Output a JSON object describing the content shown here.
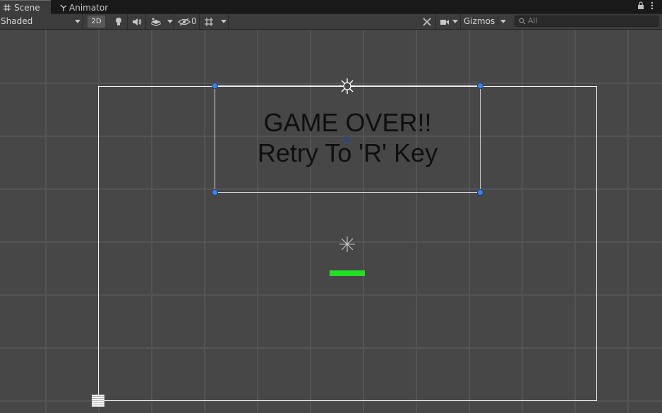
{
  "tabs": [
    {
      "label": "Scene",
      "icon": "grid-icon",
      "active": true
    },
    {
      "label": "Animator",
      "icon": "animator-icon",
      "active": false
    }
  ],
  "window_controls": [
    "lock-icon",
    "kebab-menu-icon"
  ],
  "toolbar": {
    "draw_mode": "Shaded",
    "mode_2d": "2D",
    "hidden_count": "0",
    "gizmos_label": "Gizmos",
    "search_placeholder": "All"
  },
  "scene": {
    "ui_text_line1": "GAME OVER!!",
    "ui_text_line2": "Retry To 'R' Key",
    "paddle_color": "#22e022",
    "background_color": "#474747",
    "grid_color": "#545454"
  }
}
